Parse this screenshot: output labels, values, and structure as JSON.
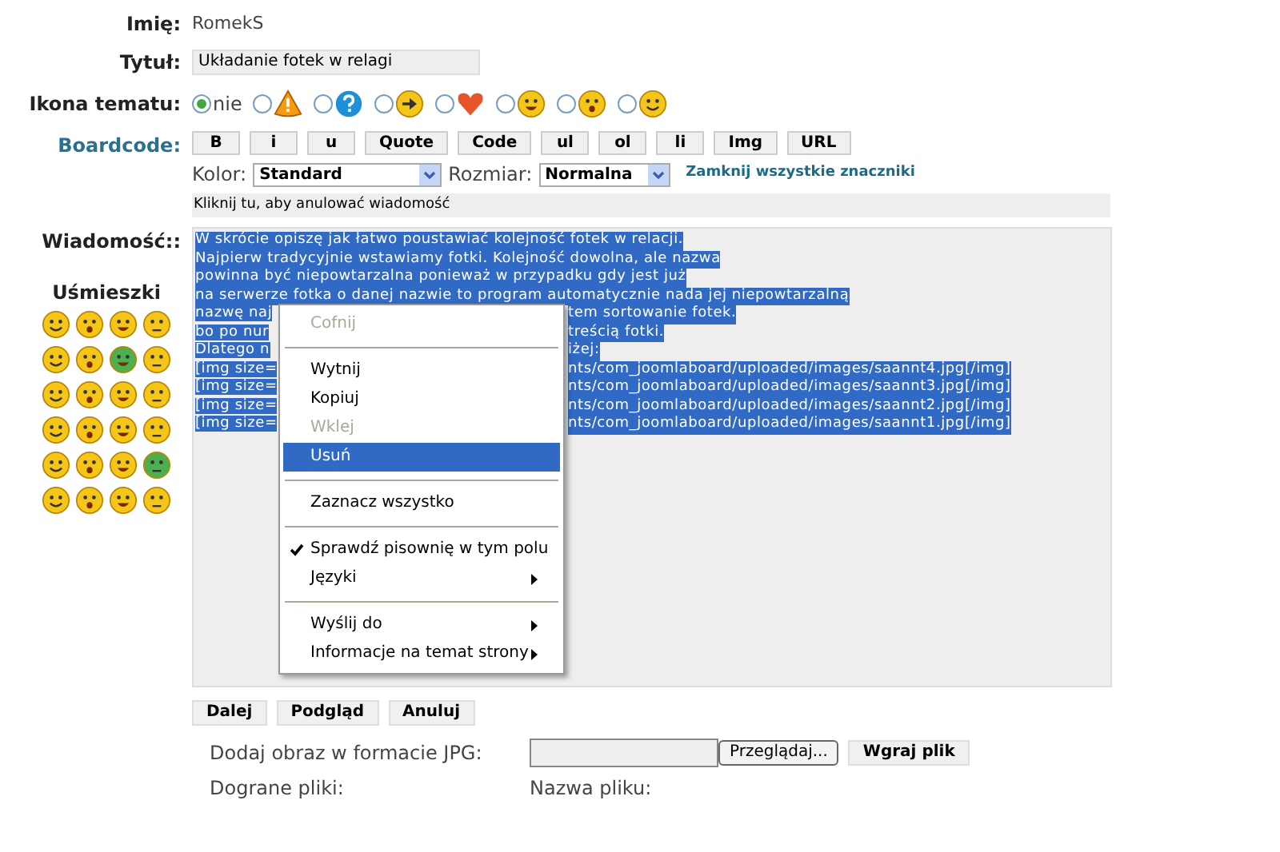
{
  "fields": [
    {
      "label": "Imię:",
      "value": "RomekS"
    },
    {
      "label": "Tytuł:",
      "value": "Układanie fotek w relagi"
    }
  ],
  "topic_icon": {
    "label": "Ikona tematu:",
    "options": [
      {
        "text": "nie",
        "selected": true
      },
      {
        "selected": false
      },
      {
        "selected": false
      },
      {
        "selected": false
      },
      {
        "selected": false
      },
      {
        "selected": false
      },
      {
        "selected": false
      },
      {
        "selected": false
      }
    ]
  },
  "boardcode": {
    "label": "Boardcode:",
    "buttons": [
      "B",
      "i",
      "u",
      "Quote",
      "Code",
      "ul",
      "ol",
      "li",
      "Img",
      "URL"
    ],
    "color_label": "Kolor:",
    "color_value": "Standard",
    "size_label": "Rozmiar:",
    "size_value": "Normalna",
    "close_tags_link": "Zamknij wszystkie znaczniki",
    "cancel_hint": "Kliknij tu, aby anulować wiadomość"
  },
  "message": {
    "label": "Wiadomość::",
    "smileys_title": "Uśmieszki",
    "lines": [
      {
        "left": "W skrócie opiszę jak łatwo poustawiać kolejność fotek w relacji."
      },
      {
        "left": "Najpierw tradycyjnie wstawiamy fotki. Kolejność dowolna, ale nazwa"
      },
      {
        "left": "powinna być niepowtarzalna ponieważ w przypadku gdy jest już"
      },
      {
        "left": "na serwerze fotka o danej nazwie to program automatycznie nada jej niepowtarzalną"
      },
      {
        "left": "nazwę naj",
        "right": "tem sortowanie fotek."
      },
      {
        "left": "bo po nur",
        "right": "treścią fotki."
      },
      {
        "left": "Dlatego n",
        "right": "iżej:"
      },
      {
        "left": "[img size=",
        "right": "nts/com_joomlaboard/uploaded/images/saannt4.jpg[/img]"
      },
      {
        "left": "[img size=",
        "right": "nts/com_joomlaboard/uploaded/images/saannt3.jpg[/img]"
      },
      {
        "left": "[img size=",
        "right": "nts/com_joomlaboard/uploaded/images/saannt2.jpg[/img]"
      },
      {
        "left": "[img size=",
        "right": "nts/com_joomlaboard/uploaded/images/saannt1.jpg[/img]"
      }
    ]
  },
  "context_menu": [
    {
      "kind": "item",
      "label": "Cofnij",
      "disabled": true,
      "selected": false
    },
    {
      "kind": "separator"
    },
    {
      "kind": "item",
      "label": "Wytnij",
      "disabled": false,
      "selected": false
    },
    {
      "kind": "item",
      "label": "Kopiuj",
      "disabled": false,
      "selected": false
    },
    {
      "kind": "item",
      "label": "Wklej",
      "disabled": true,
      "selected": false
    },
    {
      "kind": "item",
      "label": "Usuń",
      "disabled": false,
      "selected": true
    },
    {
      "kind": "separator"
    },
    {
      "kind": "item",
      "label": "Zaznacz wszystko",
      "disabled": false,
      "selected": false
    },
    {
      "kind": "separator"
    },
    {
      "kind": "item",
      "label": "Sprawdź pisownię w tym polu",
      "disabled": false,
      "selected": false,
      "checked": true
    },
    {
      "kind": "submenu",
      "label": "Języki",
      "disabled": false,
      "selected": false
    },
    {
      "kind": "separator"
    },
    {
      "kind": "submenu",
      "label": "Wyślij do",
      "disabled": false,
      "selected": false
    },
    {
      "kind": "submenu",
      "label": "Informacje na temat strony",
      "disabled": false,
      "selected": false
    }
  ],
  "form_buttons": [
    "Dalej",
    "Podgląd",
    "Anuluj"
  ],
  "upload": {
    "label": "Dodaj obraz w formacie JPG:",
    "browse_button": "Przeglądaj...",
    "upload_button": "Wgraj plik"
  },
  "uploaded": {
    "label": "Dograne pliki:",
    "file_name_label": "Nazwa pliku:"
  }
}
